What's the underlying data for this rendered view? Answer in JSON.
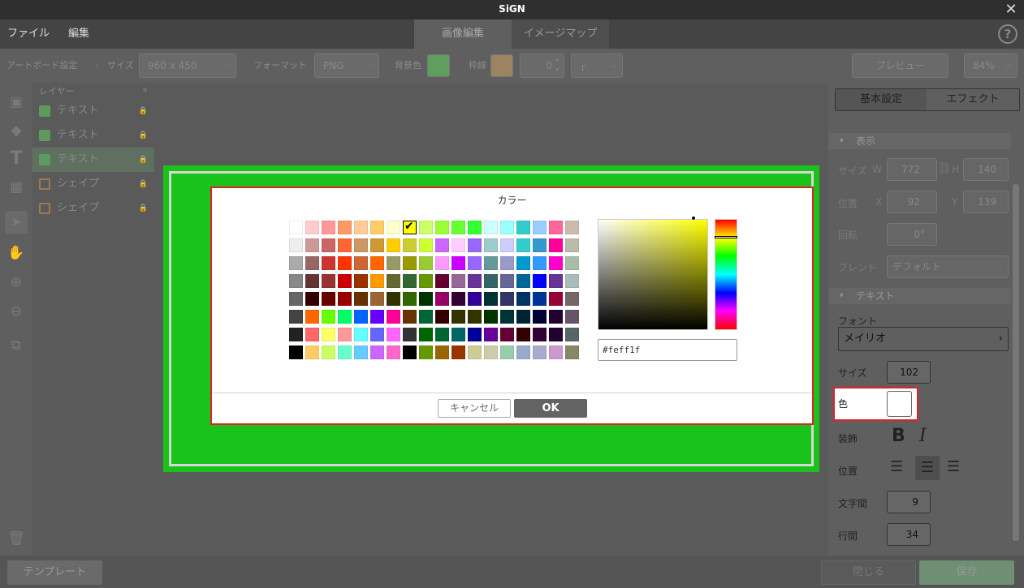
{
  "app": {
    "title": "SiGN"
  },
  "menu": {
    "file": "ファイル",
    "edit": "編集"
  },
  "tabs": [
    {
      "label": "画像編集"
    },
    {
      "label": "イメージマップ"
    }
  ],
  "help_icon": "?",
  "toolbar": {
    "artboard_label": "アートボード設定",
    "size_label": "サイズ",
    "size_value": "960 x 450",
    "format_label": "フォーマット",
    "format_value": "PNG",
    "bg_label": "背景色",
    "bg_color": "#7ed27e",
    "border_label": "枠線",
    "border_color": "#e2b66f",
    "border_width": "0",
    "preview_label": "プレビュー",
    "zoom_value": "84%"
  },
  "layers": {
    "title": "レイヤー",
    "collapse": "«",
    "items": [
      {
        "label": "テキスト",
        "type": "text"
      },
      {
        "label": "テキスト",
        "type": "text"
      },
      {
        "label": "テキスト",
        "type": "text"
      },
      {
        "label": "シェイプ",
        "type": "shape"
      },
      {
        "label": "シェイプ",
        "type": "shape"
      }
    ]
  },
  "right_panel": {
    "tabs": {
      "basic": "基本設定",
      "effect": "エフェクト"
    },
    "display_section": "表示",
    "size_label": "サイズ",
    "w_label": "W",
    "w_value": "772",
    "h_label": "H",
    "h_value": "140",
    "pos_label": "位置",
    "x_label": "X",
    "x_value": "92",
    "y_label": "Y",
    "y_value": "139",
    "rotate_label": "回転",
    "rotate_value": "0°",
    "blend_label": "ブレンド",
    "blend_value": "デフォルト",
    "text_section": "テキスト",
    "font_label": "フォント",
    "font_value": "メイリオ",
    "fsize_label": "サイズ",
    "fsize_value": "102",
    "color_label": "色",
    "deco_label": "装飾",
    "align_label": "位置",
    "spacing_label": "文字間",
    "spacing_value": "9",
    "line_label": "行間",
    "line_value": "34"
  },
  "bottom": {
    "template": "テンプレート",
    "close": "閉じる",
    "save": "保存"
  },
  "dialog": {
    "title": "カラー",
    "hex_value": "#feff1f",
    "cancel": "キャンセル",
    "ok": "OK",
    "selected_color": "#ffff00",
    "palette": [
      [
        "#ffffff",
        "#ffcccc",
        "#ff9999",
        "#ff9966",
        "#ffcc99",
        "#ffcc66",
        "#ffffcc",
        "#ffff00",
        "#ccff66",
        "#99ff33",
        "#66ff33",
        "#33ff33",
        "#ccffff",
        "#99ffff",
        "#33cccc",
        "#99ccff",
        "#ff6699",
        "#ccbbaa"
      ],
      [
        "#eeeeee",
        "#cc9999",
        "#cc6666",
        "#ff6633",
        "#cc9966",
        "#cc9933",
        "#ffcc00",
        "#cccc33",
        "#ccff33",
        "#cc66ff",
        "#ffccff",
        "#9966ff",
        "#99cccc",
        "#ccccff",
        "#33cccc",
        "#3399cc",
        "#ff0099",
        "#bbbbaa"
      ],
      [
        "#aaaaaa",
        "#996666",
        "#cc3333",
        "#ff3300",
        "#cc6633",
        "#ff6600",
        "#999966",
        "#999900",
        "#99cc33",
        "#ff99ff",
        "#cc00ff",
        "#9966ff",
        "#669999",
        "#9999cc",
        "#0099cc",
        "#3399ff",
        "#ff00cc",
        "#aabbaa"
      ],
      [
        "#888888",
        "#663333",
        "#993333",
        "#cc0000",
        "#993300",
        "#ff9900",
        "#666633",
        "#336633",
        "#669900",
        "#660033",
        "#996699",
        "#663399",
        "#336666",
        "#666699",
        "#006699",
        "#0000ff",
        "#663399",
        "#aabbbb"
      ],
      [
        "#666666",
        "#330000",
        "#660000",
        "#990000",
        "#663300",
        "#996633",
        "#333300",
        "#336600",
        "#003300",
        "#990066",
        "#330033",
        "#330099",
        "#003333",
        "#333366",
        "#003366",
        "#003399",
        "#990033",
        "#776666"
      ],
      [
        "#444444",
        "#ff6600",
        "#66ff00",
        "#00ff66",
        "#0066ff",
        "#6600ff",
        "#ff0099",
        "#663300",
        "#006633",
        "#330000",
        "#333300",
        "#333300",
        "#003300",
        "#003333",
        "#002233",
        "#000033",
        "#220033",
        "#665566"
      ],
      [
        "#222222",
        "#ff6666",
        "#ffff66",
        "#ff9999",
        "#66ffff",
        "#6666ff",
        "#ff66ff",
        "#333333",
        "#006600",
        "#006633",
        "#006666",
        "#000099",
        "#660099",
        "#660033",
        "#330000",
        "#330033",
        "#220033",
        "#556666"
      ],
      [
        "#000000",
        "#ffcc66",
        "#ccff66",
        "#66ffcc",
        "#66ccff",
        "#cc66ff",
        "#ff66cc",
        "#000000",
        "#669900",
        "#996600",
        "#993300",
        "#cccc99",
        "#ccccaa",
        "#99ccaa",
        "#99aacc",
        "#aaaacc",
        "#cc99cc",
        "#888866"
      ]
    ]
  }
}
